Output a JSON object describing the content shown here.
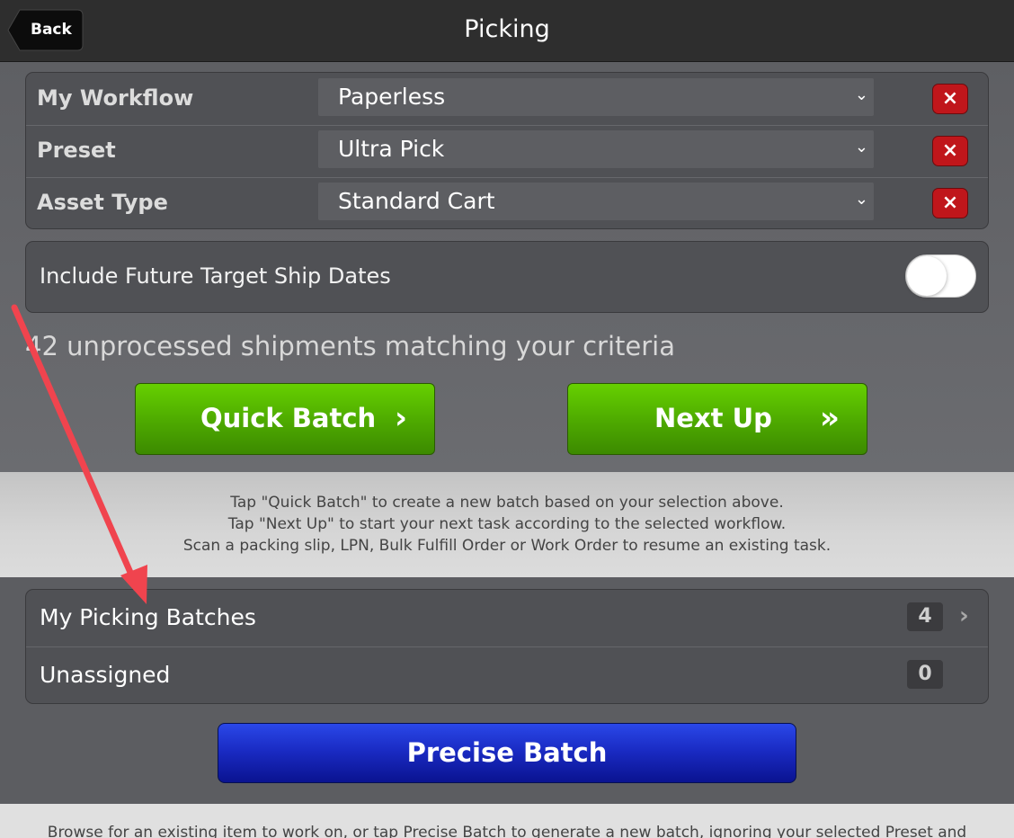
{
  "header": {
    "back_label": "Back",
    "title": "Picking"
  },
  "filters": [
    {
      "label": "My Workflow",
      "value": "Paperless"
    },
    {
      "label": "Preset",
      "value": "Ultra Pick"
    },
    {
      "label": "Asset Type",
      "value": "Standard Cart"
    }
  ],
  "clear_icon": "×",
  "dropdown_icon": "⌄",
  "future_dates": {
    "label": "Include Future Target Ship Dates",
    "enabled": false
  },
  "criteria_text": "42 unprocessed shipments matching your criteria",
  "actions": {
    "quick_batch": "Quick Batch",
    "quick_batch_icon": "›",
    "next_up": "Next Up",
    "next_up_icon": "»"
  },
  "help_primary": [
    "Tap \"Quick Batch\" to create a new batch based on your selection above.",
    "Tap \"Next Up\" to start your next task according to the selected workflow.",
    "Scan a packing slip, LPN, Bulk Fulfill Order or Work Order to resume an existing task."
  ],
  "batch_list": [
    {
      "label": "My Picking Batches",
      "count": "4",
      "chevron": "›"
    },
    {
      "label": "Unassigned",
      "count": "0"
    }
  ],
  "precise_batch": "Precise Batch",
  "help_secondary": "Browse for an existing item to work on, or tap Precise Batch to generate a new batch, ignoring your selected Preset and",
  "colors": {
    "annotation_arrow": "#f0444e",
    "green_button": "#55b800",
    "blue_button": "#1a2bc4",
    "clear_button": "#c0161b"
  }
}
